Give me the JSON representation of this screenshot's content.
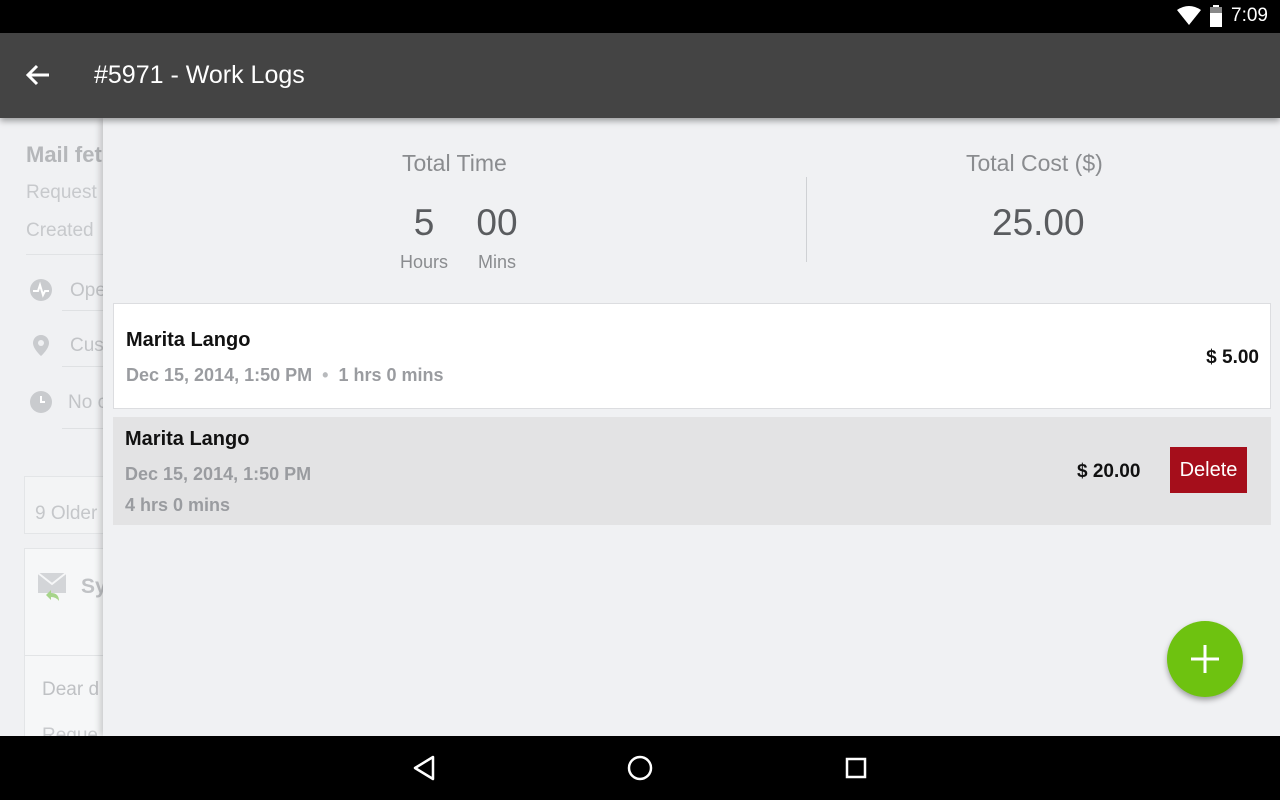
{
  "status_bar": {
    "time": "7:09",
    "icons": [
      "wifi-icon",
      "battery-icon"
    ]
  },
  "app_bar": {
    "title": "#5971 - Work Logs",
    "back_icon": "arrow-back-icon"
  },
  "background": {
    "title": "Mail fet",
    "requester_line": "Request",
    "created_line": "Created",
    "status_value": "Ope",
    "site_value": "Cus",
    "due_value": "No c",
    "older_label": "9 Older",
    "card_title": "Sy",
    "card_body": "Dear d",
    "card_body_2": "Reque"
  },
  "summary": {
    "total_time_label": "Total Time",
    "hours_value": "5",
    "hours_unit": "Hours",
    "mins_value": "00",
    "mins_unit": "Mins",
    "total_cost_label": "Total Cost ($)",
    "total_cost_value": "25.00"
  },
  "work_logs": [
    {
      "technician": "Marita Lango",
      "date": "Dec 15, 2014, 1:50 PM",
      "duration": "1 hrs 0 mins",
      "cost": "$ 5.00"
    },
    {
      "technician": "Marita Lango",
      "date": "Dec 15, 2014, 1:50 PM",
      "duration": "4 hrs 0 mins",
      "cost": "$ 20.00",
      "delete_label": "Delete"
    }
  ],
  "colors": {
    "app_bar": "#444444",
    "fab": "#6ec210",
    "delete": "#a50e1b",
    "panel_bg": "#f0f1f3"
  },
  "fab": {
    "icon": "plus-icon"
  },
  "nav_bar": {
    "icons": [
      "back-triangle-icon",
      "home-circle-icon",
      "recents-square-icon"
    ]
  }
}
